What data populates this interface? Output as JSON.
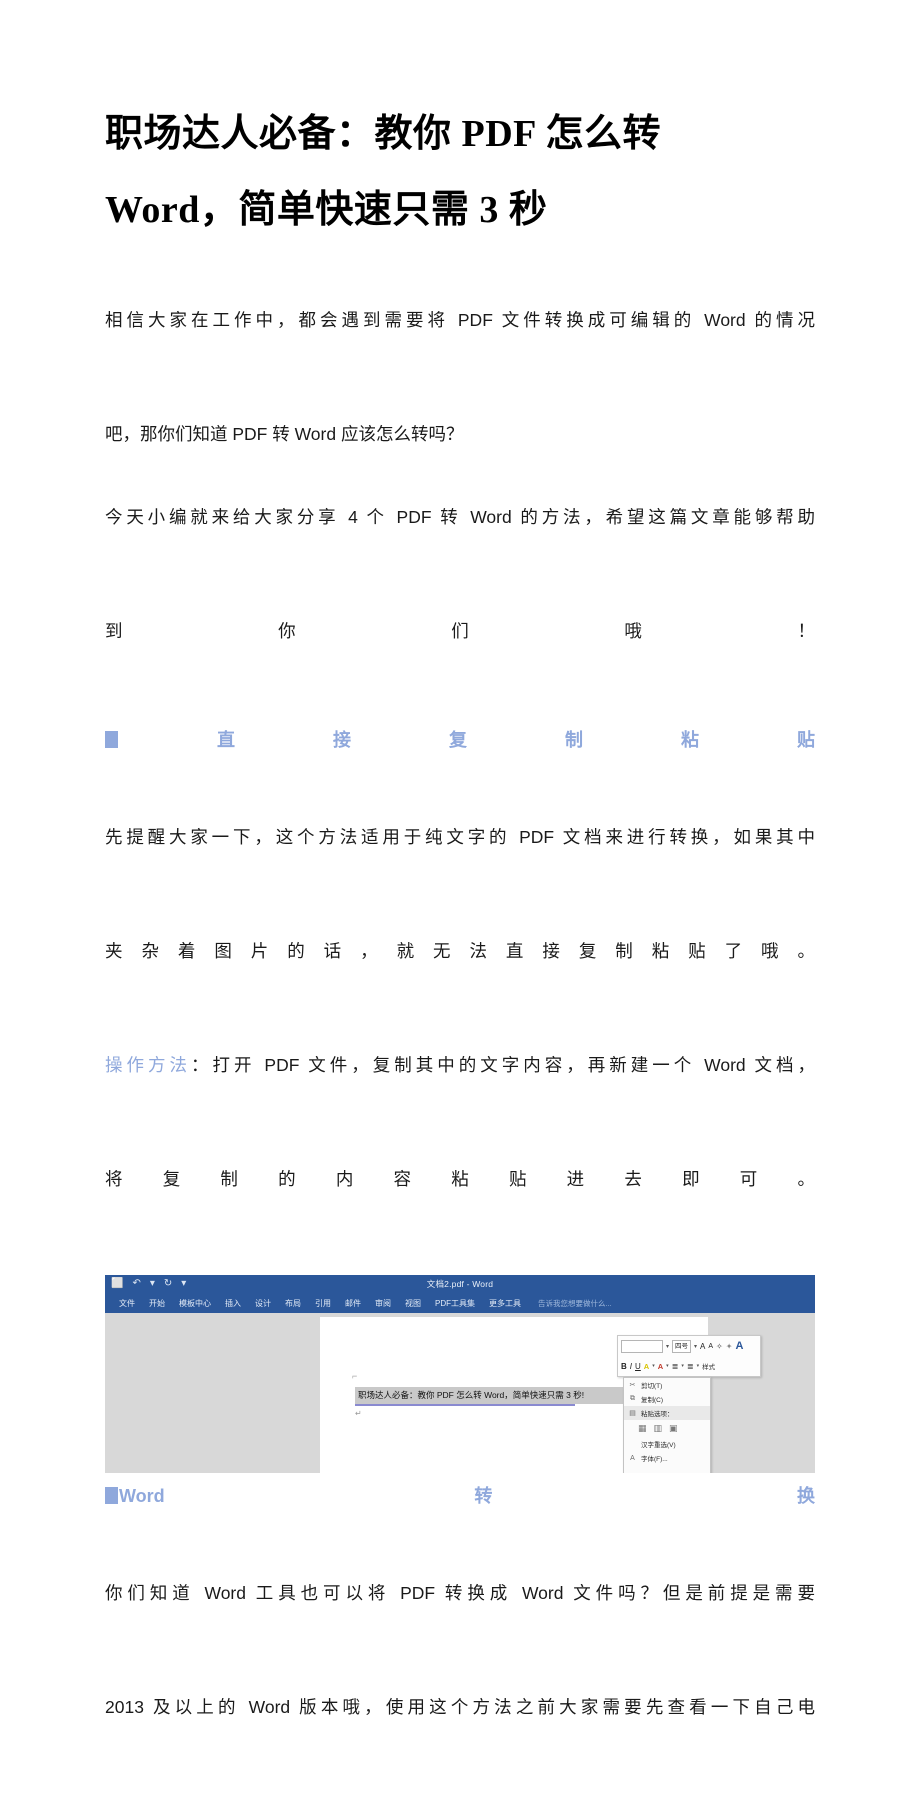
{
  "article": {
    "title_line1": "职场达人必备：教你 PDF 怎么转",
    "title_line2": "Word，简单快速只需 3 秒",
    "paragraph1_line1": "相信大家在工作中，都会遇到需要将 PDF 文件转换成可编辑的 Word 的情况",
    "paragraph1_line2": "吧，那你们知道 PDF 转 Word 应该怎么转吗？",
    "paragraph2_line1": "今天小编就来给大家分享 4 个 PDF 转 Word 的方法，希望这篇文章能够帮助",
    "paragraph2_line2": "到你们哦！",
    "heading1": "直接复制粘贴",
    "paragraph3_line1": "先提醒大家一下，这个方法适用于纯文字的 PDF 文档来进行转换，如果其中",
    "paragraph3_line2": "夹杂着图片的话，就无法直接复制粘贴了哦。",
    "method_label": "操作方法",
    "method_colon": "：",
    "paragraph4_line1": "打开 PDF 文件，复制其中的文字内容，再新建一个 Word 文档，",
    "paragraph4_line2": "将复制的内容粘贴进去即可。",
    "heading2": "Word 转换",
    "paragraph5_line1": "你们知道 Word 工具也可以将 PDF 转换成 Word 文件吗？但是前提是需要",
    "paragraph5_line2": "2013 及以上的 Word 版本哦，使用这个方法之前大家需要先查看一下自己电"
  },
  "colors": {
    "accent_blue": "#8FA8DC",
    "word_blue": "#2B579A",
    "text_black": "#1a1a1a",
    "canvas_gray": "#d8d8d8"
  },
  "word_screenshot": {
    "titlebar": {
      "document_title": "文档2.pdf - Word",
      "quick_access": [
        {
          "name": "save-icon",
          "glyph": "⬜"
        },
        {
          "name": "undo-icon",
          "glyph": "↶"
        },
        {
          "name": "undo-dropdown-icon",
          "glyph": "▾"
        },
        {
          "name": "redo-icon",
          "glyph": "↻"
        },
        {
          "name": "qat-customize-icon",
          "glyph": "▾"
        }
      ]
    },
    "ribbon_tabs": [
      "文件",
      "开始",
      "模板中心",
      "插入",
      "设计",
      "布局",
      "引用",
      "邮件",
      "审阅",
      "视图",
      "PDF工具集",
      "更多工具"
    ],
    "ribbon_search_placeholder": "告诉我您想要做什么...",
    "document": {
      "selected_text": "职场达人必备：教你 PDF 怎么转 Word，简单快速只需 3 秒!",
      "paragraph_mark": "↵"
    },
    "mini_toolbar": {
      "font_name_value": "",
      "font_size_value": "四号",
      "grow_font_label": "A",
      "shrink_font_label": "A",
      "bold_label": "B",
      "italic_label": "I",
      "underline_label": "U",
      "highlight_label": "A",
      "font_color_label": "A",
      "bullets_label": "≣",
      "numbering_label": "≣",
      "styles_label": "样式",
      "format_painter_label": "A"
    },
    "context_menu": {
      "items": [
        {
          "icon": "scissors-icon",
          "glyph": "✂",
          "label": "剪切(T)"
        },
        {
          "icon": "copy-icon",
          "glyph": "⧉",
          "label": "复制(C)"
        },
        {
          "icon": "paste-icon",
          "glyph": "Ὄb",
          "label": "粘贴选项："
        }
      ],
      "paste_options": [
        {
          "name": "paste-keep-source-icon",
          "glyph": "▦"
        },
        {
          "name": "paste-merge-format-icon",
          "glyph": "▤"
        },
        {
          "name": "paste-text-only-icon",
          "glyph": "Ⓐ"
        }
      ],
      "extra_items": [
        {
          "icon": "",
          "glyph": "",
          "label": "汉字重选(V)"
        },
        {
          "icon": "font-icon",
          "glyph": "A",
          "label": "字体(F)..."
        }
      ]
    }
  }
}
